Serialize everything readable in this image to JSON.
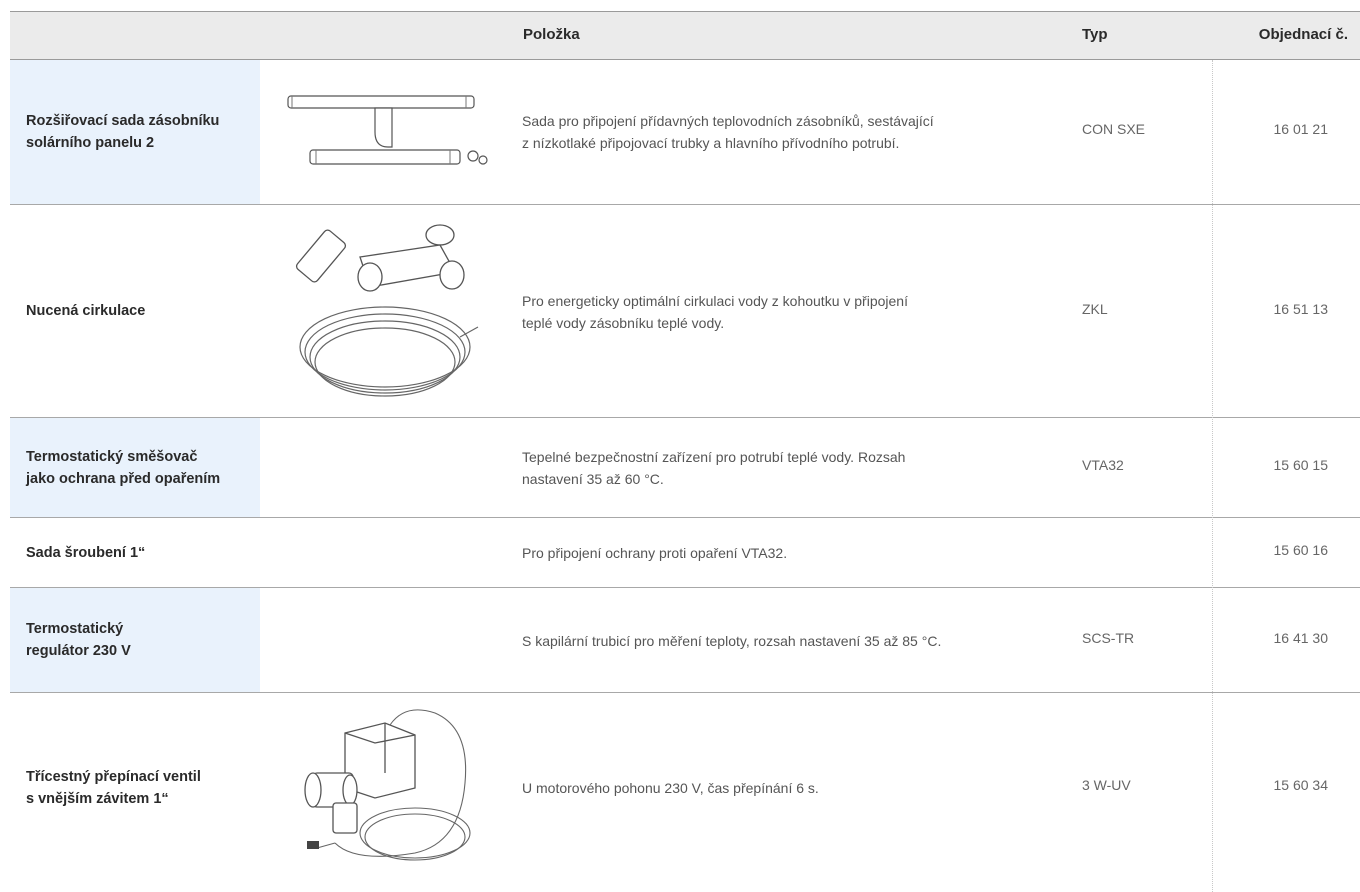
{
  "header": {
    "item": "Položka",
    "type": "Typ",
    "order": "Objednací č."
  },
  "rows": [
    {
      "name": "Rozšiřovací sada zásobníku\nsolárního panelu 2",
      "description": "Sada pro připojení přídavných teplovodních zásobníků, sestávající\nz nízkotlaké připojovací trubky a hlavního přívodního potrubí.",
      "type": "CON SXE",
      "order": "16 01 21",
      "image": "pipe-kit-image"
    },
    {
      "name": "Nucená cirkulace",
      "description": "Pro energeticky optimální cirkulaci vody z kohoutku v připojení\nteplé vody zásobníku teplé vody.",
      "type": "ZKL",
      "order": "16 51 13",
      "image": "circulation-kit-image"
    },
    {
      "name": "Termostatický směšovač\njako ochrana před opařením",
      "description": "Tepelné bezpečnostní zařízení pro potrubí teplé vody. Rozsah\nnastavení 35 až 60 °C.",
      "type": "VTA32",
      "order": "15 60 15",
      "image": ""
    },
    {
      "name": "Sada šroubení 1“",
      "description": "Pro připojení ochrany proti opaření VTA32.",
      "type": "",
      "order": "15 60 16",
      "image": ""
    },
    {
      "name": "Termostatický\nregulátor 230 V",
      "description": "S kapilární trubicí pro měření teploty, rozsah nastavení 35 až 85 °C.",
      "type": "SCS-TR",
      "order": "16 41 30",
      "image": ""
    },
    {
      "name": "Třícestný přepínací ventil\ns vnějším závitem 1“",
      "description": "U motorového pohonu 230 V, čas přepínání 6 s.",
      "type": "3 W-UV",
      "order": "15 60 34",
      "image": "valve-image"
    }
  ]
}
